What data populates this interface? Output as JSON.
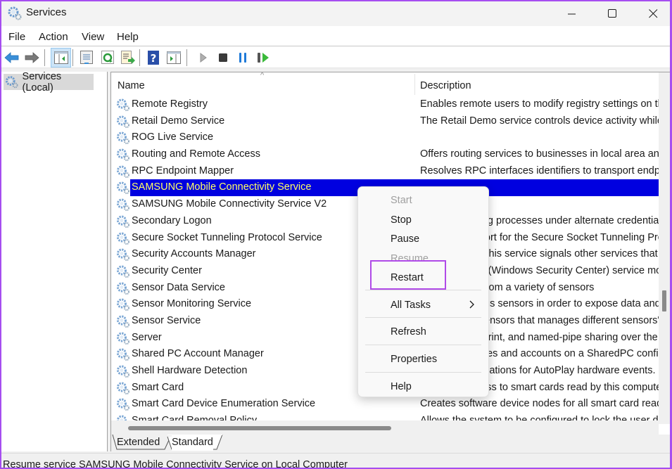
{
  "window": {
    "title": "Services",
    "accent_border": "#a64ef0"
  },
  "menubar": [
    "File",
    "Action",
    "View",
    "Help"
  ],
  "toolbar": {
    "icons": [
      "back-arrow-icon",
      "forward-arrow-icon",
      "show-hide-console-tree-icon",
      "properties-icon",
      "refresh-icon",
      "export-list-icon",
      "help-icon",
      "show-action-pane-icon",
      "start-service-icon",
      "stop-service-icon",
      "pause-service-icon",
      "restart-service-icon"
    ]
  },
  "tree": {
    "root": "Services (Local)"
  },
  "list": {
    "columns": [
      "Name",
      "Description"
    ],
    "rows": [
      {
        "name": "Remote Registry",
        "desc": "Enables remote users to modify registry settings on th"
      },
      {
        "name": "Retail Demo Service",
        "desc": "The Retail Demo service controls device activity while t"
      },
      {
        "name": "ROG Live Service",
        "desc": ""
      },
      {
        "name": "Routing and Remote Access",
        "desc": "Offers routing services to businesses in local area and"
      },
      {
        "name": "RPC Endpoint Mapper",
        "desc": "Resolves RPC interfaces identifiers to transport endpoi"
      },
      {
        "name": "SAMSUNG Mobile Connectivity Service",
        "desc": "",
        "selected": true
      },
      {
        "name": "SAMSUNG Mobile Connectivity Service V2",
        "desc": ""
      },
      {
        "name": "Secondary Logon",
        "desc": "Enables starting processes under alternate credentials"
      },
      {
        "name": "Secure Socket Tunneling Protocol Service",
        "desc": "Provides support for the Secure Socket Tunneling Prot"
      },
      {
        "name": "Security Accounts Manager",
        "desc": "The startup of this service signals other services that t"
      },
      {
        "name": "Security Center",
        "desc": "The WSCSVC (Windows Security Center) service monit"
      },
      {
        "name": "Sensor Data Service",
        "desc": "Delivers data from a variety of sensors"
      },
      {
        "name": "Sensor Monitoring Service",
        "desc": "Monitors various sensors in order to expose data and"
      },
      {
        "name": "Sensor Service",
        "desc": "A service for sensors that manages different sensors' f"
      },
      {
        "name": "Server",
        "desc": "Supports file, print, and named-pipe sharing over the"
      },
      {
        "name": "Shared PC Account Manager",
        "desc": "Manages profiles and accounts on a SharedPC configu"
      },
      {
        "name": "Shell Hardware Detection",
        "desc": "Provides notifications for AutoPlay hardware events."
      },
      {
        "name": "Smart Card",
        "desc": "Manages access to smart cards read by this computer"
      },
      {
        "name": "Smart Card Device Enumeration Service",
        "desc": "Creates software device nodes for all smart card read"
      },
      {
        "name": "Smart Card Removal Policy",
        "desc": "Allows the system to be configured to lock the user d"
      }
    ],
    "selected_color": "#0000e0",
    "selected_text_color": "#ffff66"
  },
  "tabs": [
    "Extended",
    "Standard"
  ],
  "active_tab": "Standard",
  "status": "Resume service SAMSUNG Mobile Connectivity Service on Local Computer",
  "context_menu": {
    "items": [
      {
        "label": "Start",
        "disabled": true
      },
      {
        "label": "Stop",
        "disabled": false
      },
      {
        "label": "Pause",
        "disabled": false
      },
      {
        "label": "Resume",
        "disabled": true
      },
      {
        "label": "Restart",
        "disabled": false,
        "highlighted": true
      },
      {
        "label": "All Tasks",
        "disabled": false,
        "submenu": true
      },
      {
        "label": "Refresh",
        "disabled": false
      },
      {
        "label": "Properties",
        "disabled": false
      },
      {
        "label": "Help",
        "disabled": false
      }
    ],
    "highlight_color": "#b04ae8"
  }
}
